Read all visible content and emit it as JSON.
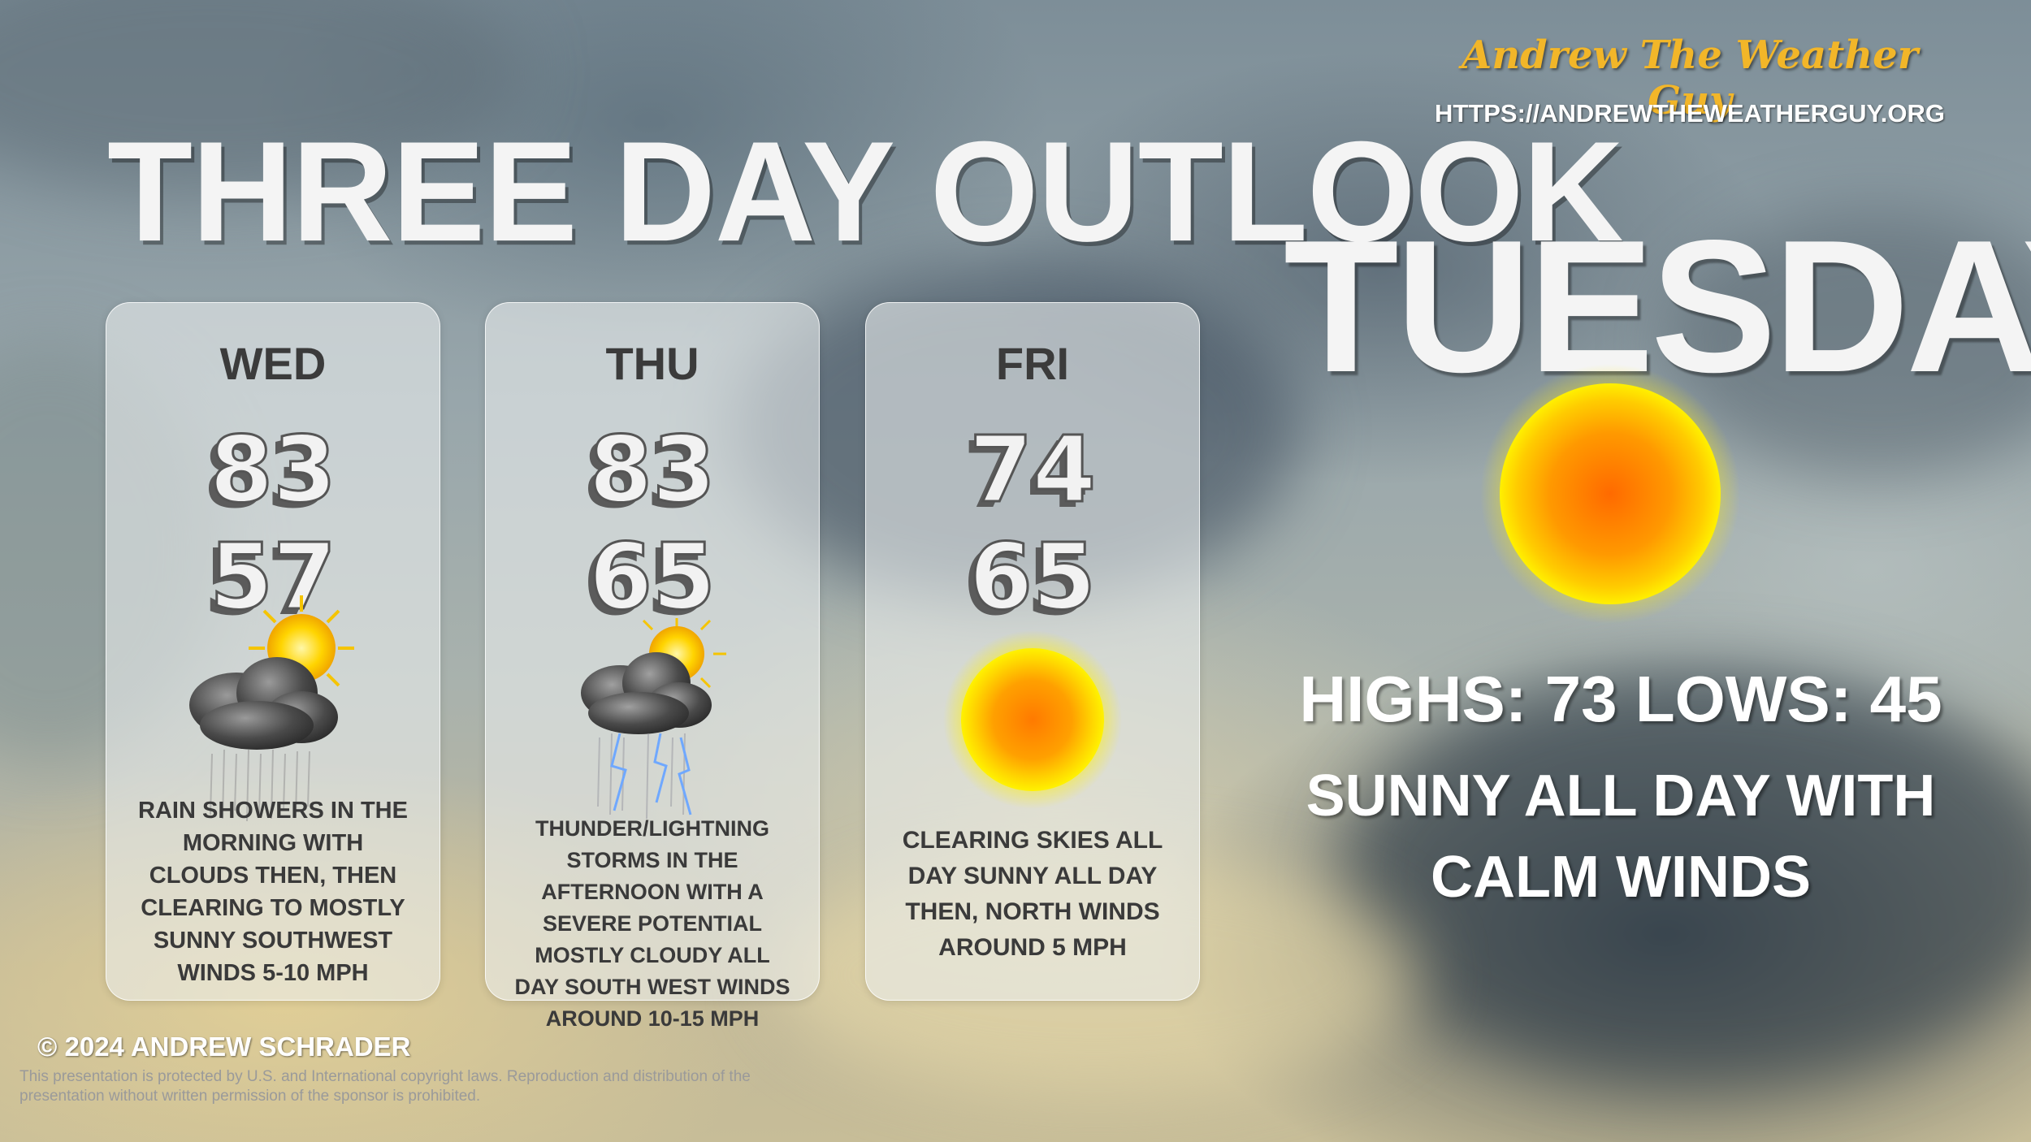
{
  "branding": {
    "name": "Andrew The Weather Guy",
    "url": "HTTPS://ANDREWTHEWEATHERGUY.ORG"
  },
  "title": "THREE DAY OUTLOOK",
  "days": [
    {
      "label": "WED",
      "high": "83",
      "low": "57",
      "icon": "sun-cloud-rain-icon",
      "description": "Rain showers in the morning with clouds then, then clearing to mostly sunny southwest winds 5-10 mph"
    },
    {
      "label": "THU",
      "high": "83",
      "low": "65",
      "icon": "sun-cloud-storm-icon",
      "description": "Thunder/Lightning storms in the afternoon with a severe potential mostly cloudy all day south west winds around 10-15 mph"
    },
    {
      "label": "FRI",
      "high": "74",
      "low": "65",
      "icon": "sun-icon",
      "description": "Clearing skies all day sunny all day then, north winds around 5 mph"
    }
  ],
  "today": {
    "name": "TUESDAY",
    "icon": "sun-icon",
    "highs_lows": "HIGHS: 73 LOWS: 45",
    "summary": "SUNNY ALL DAY WITH CALM WINDS"
  },
  "footer": {
    "copyright": "© 2024 ANDREW SCHRADER",
    "disclaimer": "This presentation is protected by U.S. and International copyright laws. Reproduction and distribution of the presentation without written permission of the sponsor is prohibited."
  },
  "colors": {
    "brand_gold": "#f2b629",
    "text_white": "#f4f4f4",
    "card_text": "#3a3a3a",
    "sun_orange": "#ff8a00",
    "sun_yellow": "#ffd200"
  }
}
